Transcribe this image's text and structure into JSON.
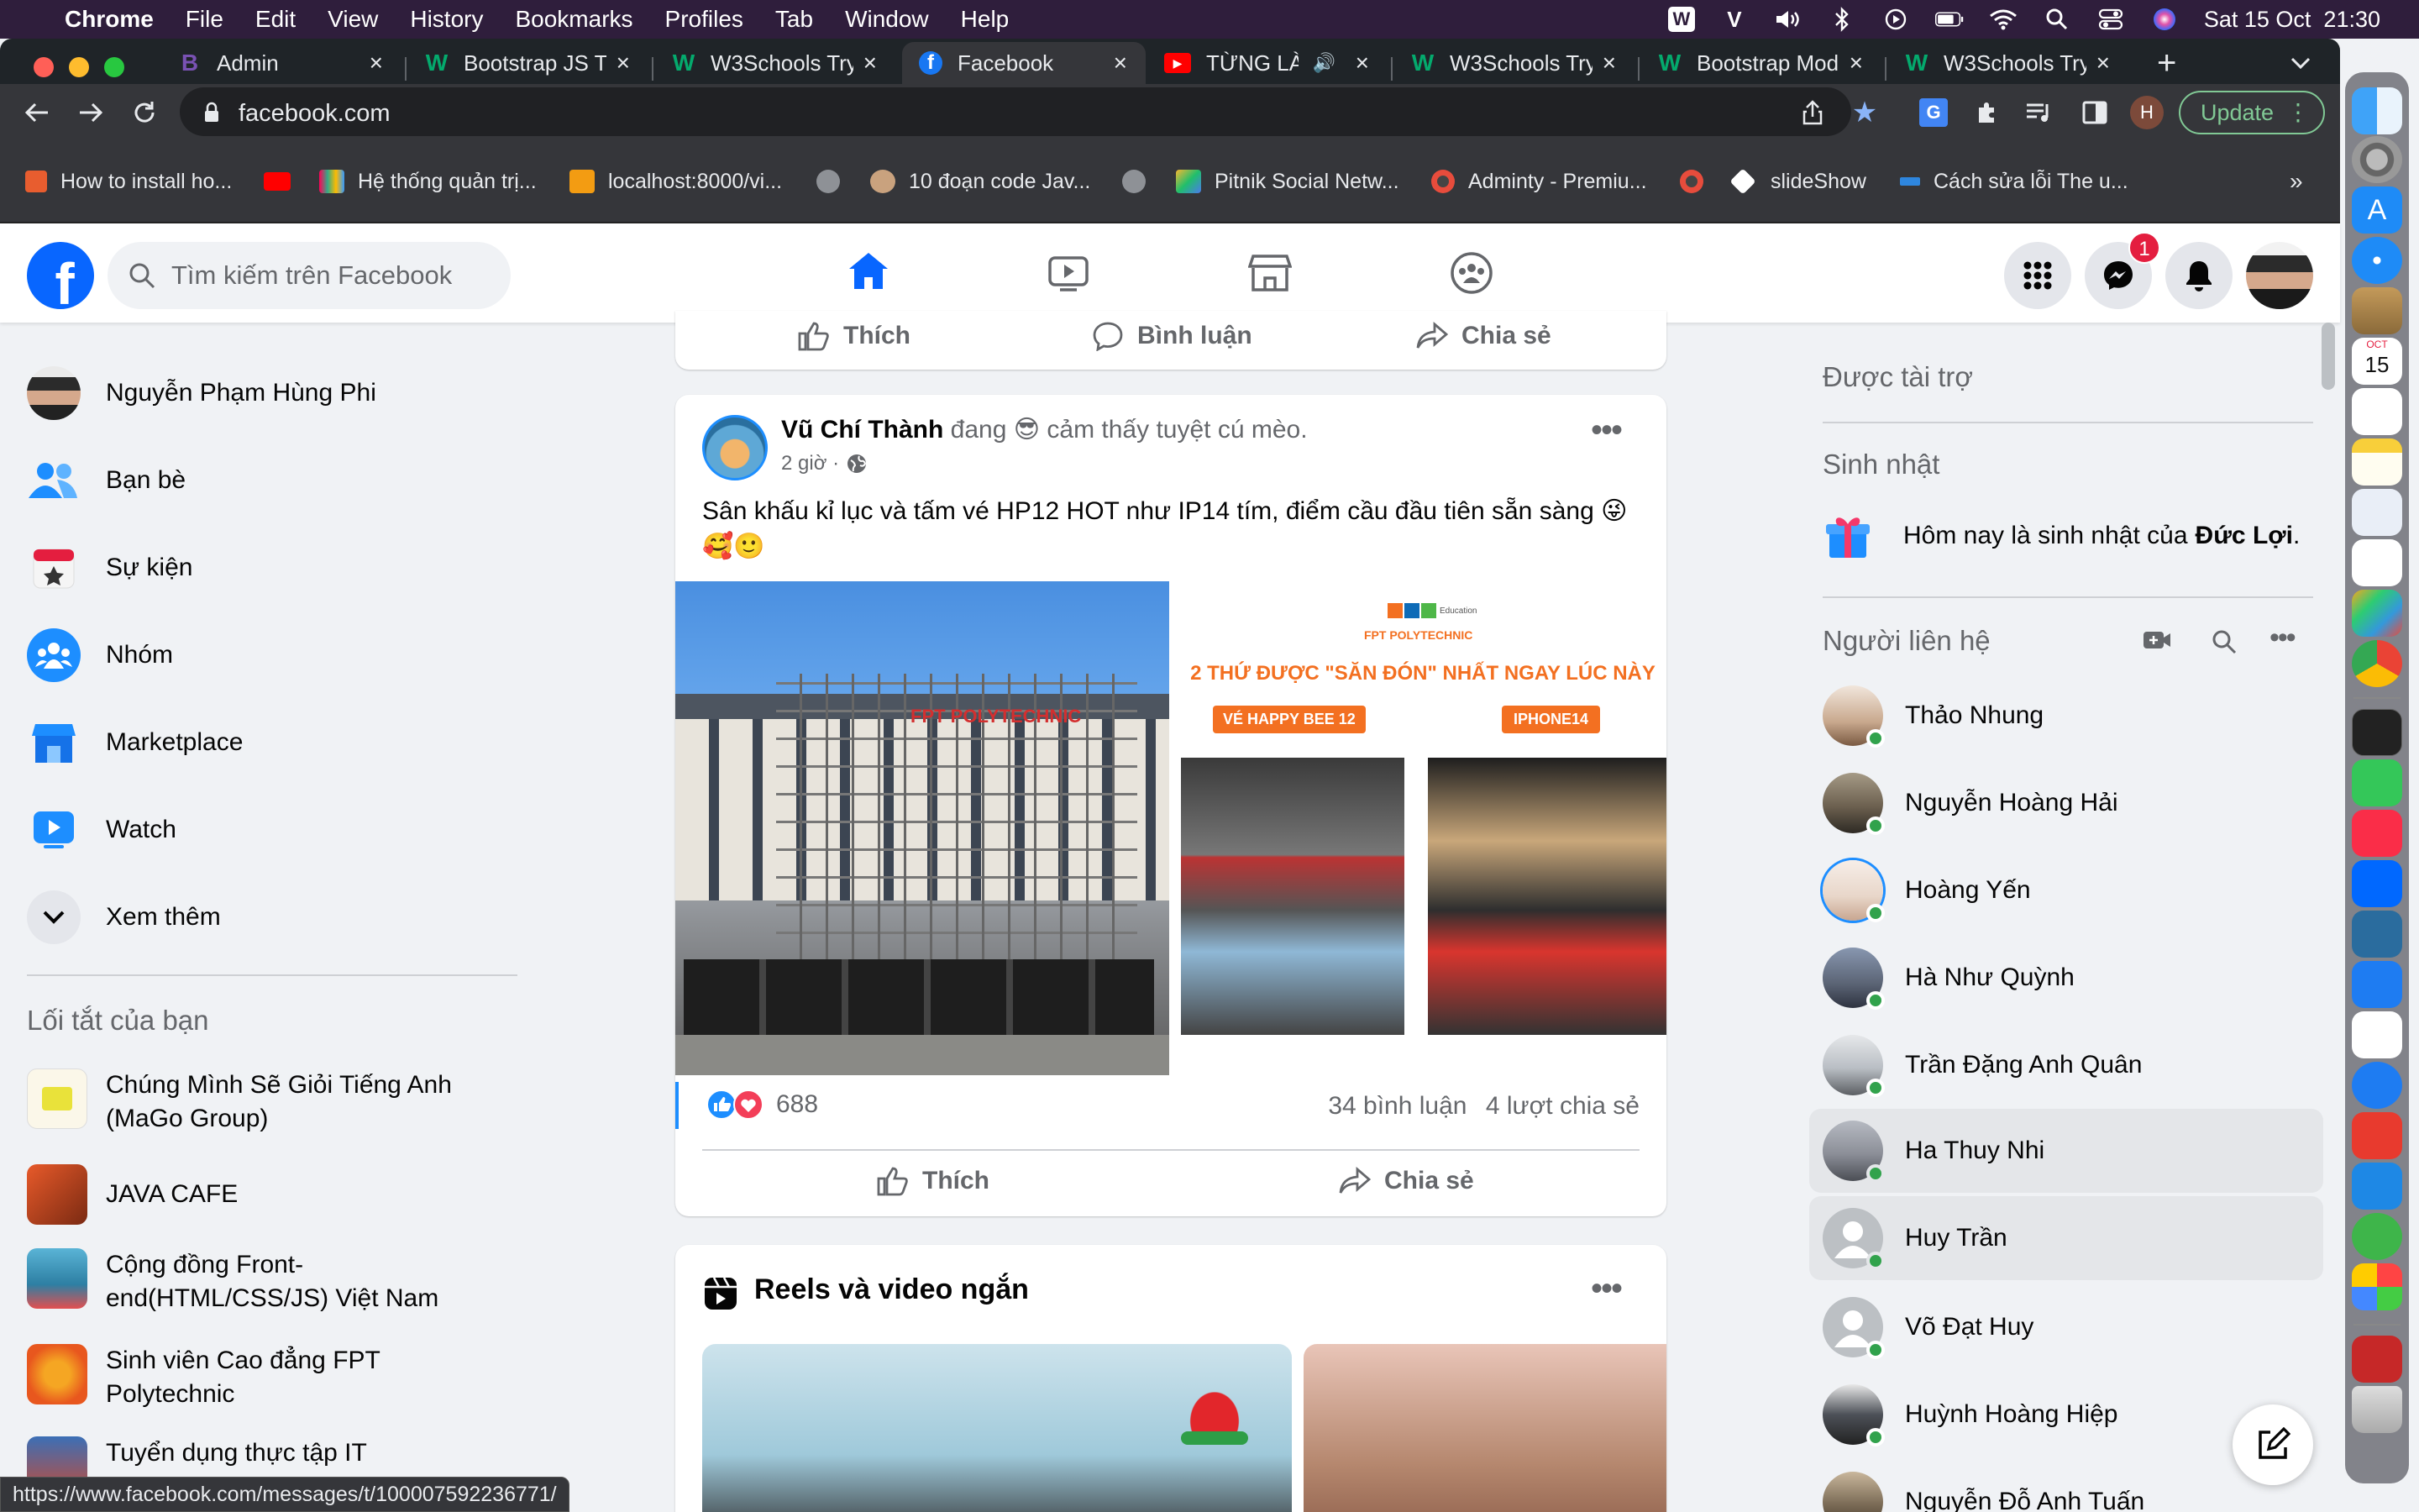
{
  "menubar": {
    "app_name": "Chrome",
    "items": [
      "File",
      "Edit",
      "View",
      "History",
      "Bookmarks",
      "Profiles",
      "Tab",
      "Window",
      "Help"
    ],
    "datetime": "Sat 15 Oct  21:30"
  },
  "tabs": [
    {
      "title": "Admin",
      "icon": "bootstrap-icon",
      "color": "#7952B3"
    },
    {
      "title": "Bootstrap JS T",
      "icon": "w3schools-icon",
      "color": "#04AA6D"
    },
    {
      "title": "W3Schools Try",
      "icon": "w3schools-icon",
      "color": "#04AA6D"
    },
    {
      "title": "Facebook",
      "icon": "facebook-icon",
      "color": "#1877F2"
    },
    {
      "title": "TỪNG LÀ",
      "icon": "youtube-icon",
      "color": "#FF0000"
    },
    {
      "title": "W3Schools Try",
      "icon": "w3schools-icon",
      "color": "#04AA6D"
    },
    {
      "title": "Bootstrap Mod",
      "icon": "w3schools-icon",
      "color": "#04AA6D"
    },
    {
      "title": "W3Schools Try",
      "icon": "w3schools-icon",
      "color": "#04AA6D"
    }
  ],
  "omnibox": {
    "url": "facebook.com"
  },
  "toolbar": {
    "update_label": "Update",
    "profile_initial": "H"
  },
  "bookmarks": [
    {
      "label": "How to install ho..."
    },
    {
      "label": ""
    },
    {
      "label": "Hệ thống quản trị..."
    },
    {
      "label": "localhost:8000/vi..."
    },
    {
      "label": ""
    },
    {
      "label": "10 đoạn code Jav..."
    },
    {
      "label": ""
    },
    {
      "label": "Pitnik Social Netw..."
    },
    {
      "label": "Adminty - Premiu..."
    },
    {
      "label": ""
    },
    {
      "label": "slideShow"
    },
    {
      "label": "Cách sửa lỗi The u..."
    }
  ],
  "bookmarks_more": "»",
  "header": {
    "logo": "f",
    "search_placeholder": "Tìm kiếm trên Facebook",
    "messenger_badge": "1"
  },
  "left_nav": {
    "items": [
      {
        "label": "Nguyễn Phạm Hùng Phi"
      },
      {
        "label": "Bạn bè"
      },
      {
        "label": "Sự kiện"
      },
      {
        "label": "Nhóm"
      },
      {
        "label": "Marketplace"
      },
      {
        "label": "Watch"
      },
      {
        "label": "Xem thêm"
      }
    ],
    "shortcuts_title": "Lối tắt của bạn",
    "shortcuts": [
      {
        "label": "Chúng Mình Sẽ Giỏi Tiếng Anh (MaGo Group)"
      },
      {
        "label": "JAVA CAFE"
      },
      {
        "label": "Cộng đồng Front-end(HTML/CSS/JS) Việt Nam"
      },
      {
        "label": "Sinh viên Cao đẳng FPT Polytechnic"
      },
      {
        "label": "Tuyển dụng thực tập IT"
      }
    ]
  },
  "prev_post": {
    "like": "Thích",
    "comment": "Bình luận",
    "share": "Chia sẻ"
  },
  "post": {
    "author": "Vũ Chí Thành",
    "feeling_prefix": "đang",
    "feeling_emoji": "😎",
    "feeling_text": "cảm thấy tuyệt cú mèo.",
    "time": "2 giờ ·",
    "text": "Sân khấu kỉ lục và tấm vé HP12 HOT như IP14 tím, điểm cầu đầu tiên sẵn sàng 😜🥰🙂",
    "image_right": {
      "brand": "FPT POLYTECHNIC",
      "brand_sub": "Education",
      "headline": "2 THỨ ĐƯỢC \"SĂN ĐÓN\" NHẤT NGAY LÚC NÀY",
      "tag_left": "VÉ HAPPY BEE 12",
      "tag_right": "IPHONE14"
    },
    "image_left": {
      "sign": "FPT POLYTECHNIC"
    },
    "reactions_count": "688",
    "comments": "34 bình luận",
    "shares": "4 lượt chia sẻ",
    "like": "Thích",
    "share": "Chia sẻ"
  },
  "reels": {
    "title": "Reels và video ngắn"
  },
  "right_col": {
    "sponsored": "Được tài trợ",
    "birthday_title": "Sinh nhật",
    "birthday_text_prefix": "Hôm nay là sinh nhật của",
    "birthday_name": "Đức Lợi",
    "birthday_suffix": ".",
    "contacts_title": "Người liên hệ",
    "contacts": [
      {
        "name": "Thảo Nhung",
        "color": "#C9A98E"
      },
      {
        "name": "Nguyễn Hoàng Hải",
        "color": "#6D6150"
      },
      {
        "name": "Hoàng Yến",
        "color": "#E8D6C9"
      },
      {
        "name": "Hà Như Quỳnh",
        "color": "#5B6475"
      },
      {
        "name": "Trần Đặng Anh Quân",
        "color": "#B9BEC4"
      },
      {
        "name": "Ha Thuy Nhi",
        "color": "#8C8F98"
      },
      {
        "name": "Huy Trần",
        "color": "#BCC0C4"
      },
      {
        "name": "Võ Đạt Huy",
        "color": "#BCC0C4"
      },
      {
        "name": "Huỳnh Hoàng Hiệp",
        "color": "#4D5158"
      },
      {
        "name": "Nguyễn Đỗ Anh Tuấn",
        "color": "#7A6A55"
      }
    ]
  },
  "status_url": "https://www.facebook.com/messages/t/100007592236771/",
  "dock": {
    "calendar_month": "OCT",
    "calendar_day": "15"
  }
}
